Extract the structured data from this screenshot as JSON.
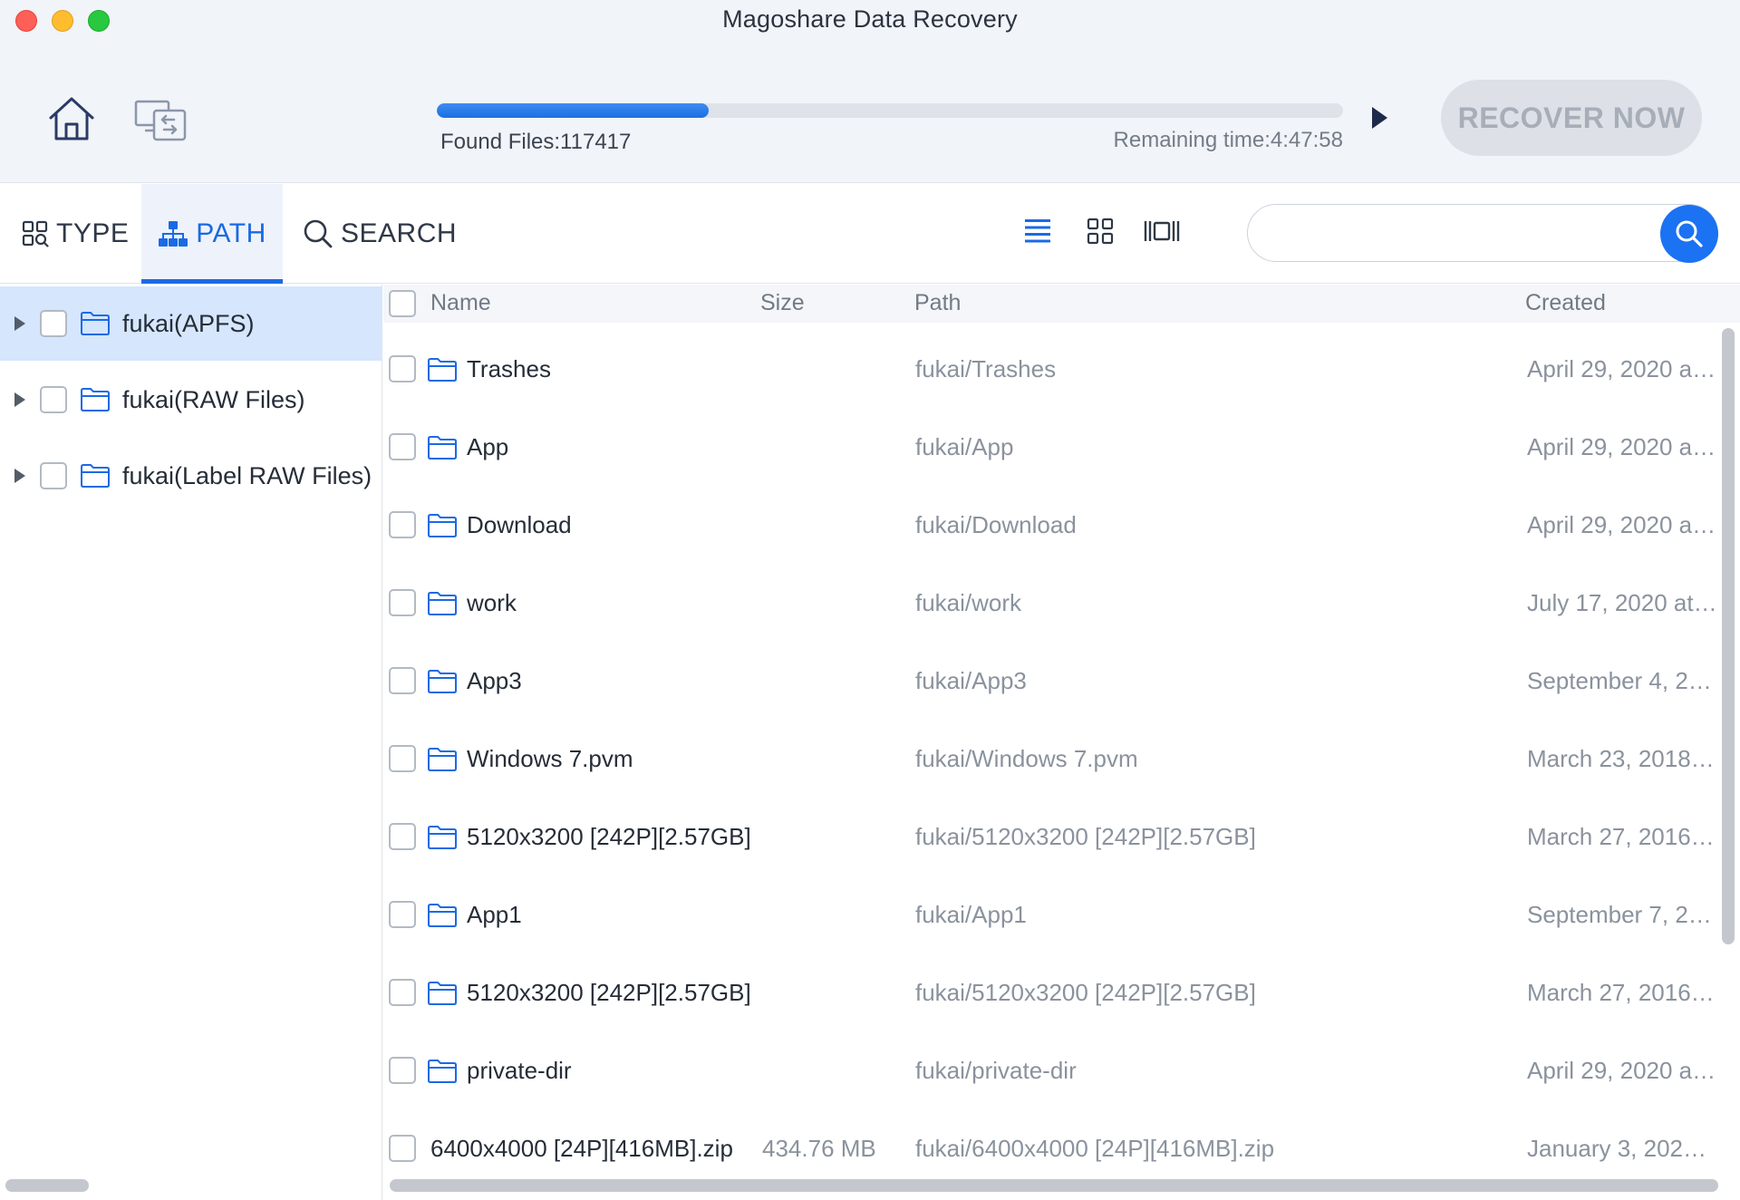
{
  "window": {
    "title": "Magoshare Data Recovery"
  },
  "toolbar": {
    "home_icon": "home-icon",
    "device_icon": "device-switch-icon",
    "progress_fraction": 0.3,
    "found_files": "Found Files:117417",
    "remaining_time": "Remaining time:4:47:58",
    "play_icon": "play-icon",
    "recover_label": "RECOVER NOW"
  },
  "tabs": [
    {
      "label": "TYPE",
      "icon": "type-grid-icon",
      "active": false
    },
    {
      "label": "PATH",
      "icon": "path-tree-icon",
      "active": true
    },
    {
      "label": "SEARCH",
      "icon": "search-icon",
      "active": false
    }
  ],
  "view_modes": [
    "list-view-icon",
    "grid-view-icon",
    "preview-view-icon"
  ],
  "search": {
    "placeholder": "",
    "value": ""
  },
  "tree": [
    {
      "label": "fukai(APFS)",
      "selected": true
    },
    {
      "label": "fukai(RAW Files)",
      "selected": false
    },
    {
      "label": "fukai(Label RAW Files)",
      "selected": false
    }
  ],
  "table": {
    "columns": {
      "name": "Name",
      "size": "Size",
      "path": "Path",
      "created": "Created"
    },
    "rows": [
      {
        "name": "Trashes",
        "size": "",
        "path": "fukai/Trashes",
        "created": "April 29, 2020 a…",
        "folder": true
      },
      {
        "name": "App",
        "size": "",
        "path": "fukai/App",
        "created": "April 29, 2020 a…",
        "folder": true
      },
      {
        "name": "Download",
        "size": "",
        "path": "fukai/Download",
        "created": "April 29, 2020 a…",
        "folder": true
      },
      {
        "name": "work",
        "size": "",
        "path": "fukai/work",
        "created": "July 17, 2020 at…",
        "folder": true
      },
      {
        "name": "App3",
        "size": "",
        "path": "fukai/App3",
        "created": "September 4, 2…",
        "folder": true
      },
      {
        "name": "Windows 7.pvm",
        "size": "",
        "path": "fukai/Windows 7.pvm",
        "created": "March 23, 2018…",
        "folder": true
      },
      {
        "name": "5120x3200 [242P][2.57GB]",
        "size": "",
        "path": "fukai/5120x3200 [242P][2.57GB]",
        "created": "March 27, 2016…",
        "folder": true
      },
      {
        "name": "App1",
        "size": "",
        "path": "fukai/App1",
        "created": "September 7, 2…",
        "folder": true
      },
      {
        "name": "5120x3200 [242P][2.57GB]",
        "size": "",
        "path": "fukai/5120x3200 [242P][2.57GB]",
        "created": "March 27, 2016…",
        "folder": true
      },
      {
        "name": "private-dir",
        "size": "",
        "path": "fukai/private-dir",
        "created": "April 29, 2020 a…",
        "folder": true
      },
      {
        "name": "6400x4000 [24P][416MB].zip",
        "size": "434.76 MB",
        "path": "fukai/6400x4000 [24P][416MB].zip",
        "created": "January 3, 2020…",
        "folder": false
      }
    ]
  },
  "colors": {
    "accent": "#1a6ae4",
    "selected_row": "#d5e6fd",
    "progress": "#1b6fe3",
    "recover_disabled": "#dde1e7"
  }
}
